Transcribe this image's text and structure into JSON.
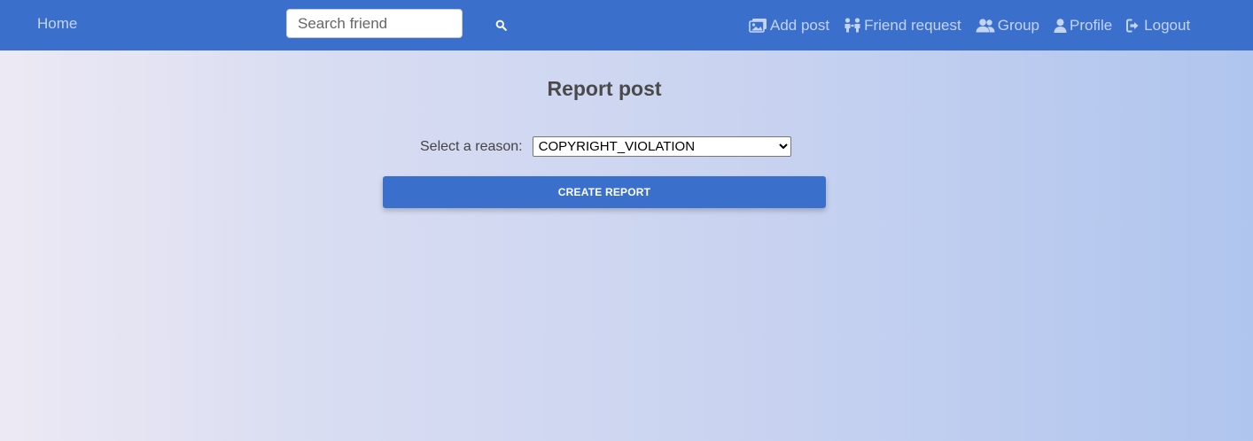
{
  "nav": {
    "home_label": "Home",
    "search_placeholder": "Search friend",
    "search_icon": "search-icon",
    "items": [
      {
        "label": "Add post",
        "icon": "add-post-icon"
      },
      {
        "label": "Friend request",
        "icon": "friend-request-icon"
      },
      {
        "label": "Group",
        "icon": "group-icon"
      },
      {
        "label": "Profile",
        "icon": "user-icon"
      },
      {
        "label": "Logout",
        "icon": "logout-icon"
      }
    ]
  },
  "main": {
    "title": "Report post",
    "reason_label": "Select a reason:",
    "selected_reason": "COPYRIGHT_VIOLATION",
    "create_button_label": "CREATE REPORT"
  },
  "colors": {
    "navbar": "#3a70cc",
    "nav_text": "#c4d4f2",
    "button": "#3a70cc"
  }
}
